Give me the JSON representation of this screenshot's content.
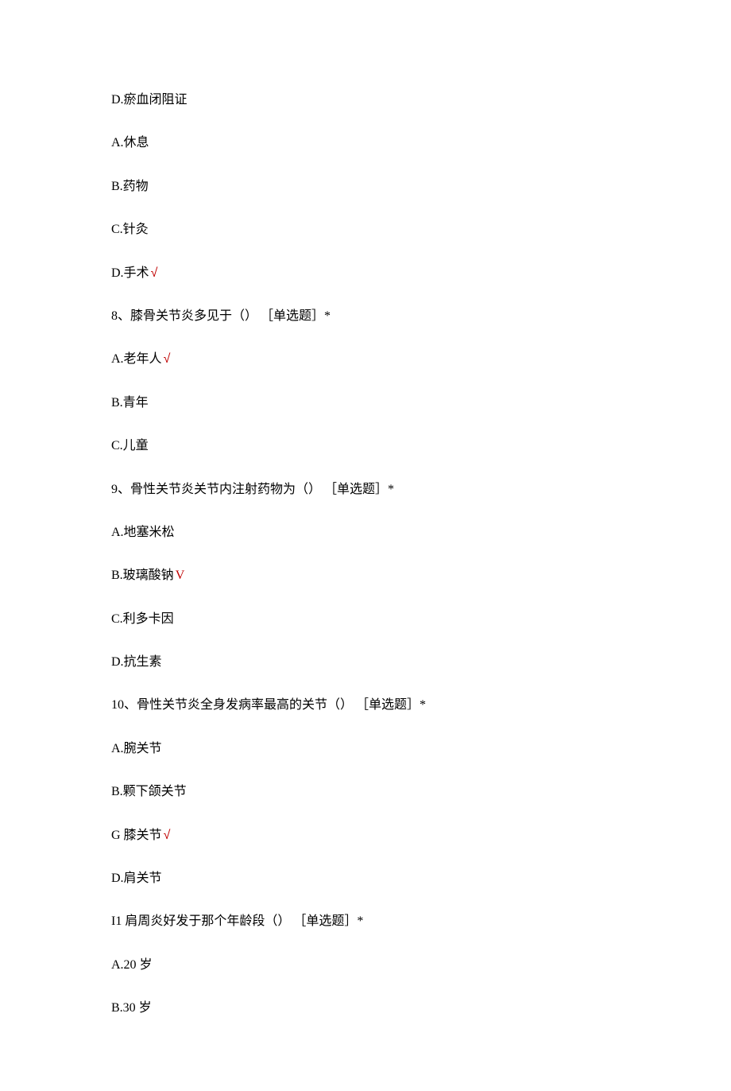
{
  "lines": [
    {
      "text": "D.瘀血闭阻证",
      "mark": null
    },
    {
      "text": "A.休息",
      "mark": null
    },
    {
      "text": "B.药物",
      "mark": null
    },
    {
      "text": "C.针灸",
      "mark": null
    },
    {
      "text": "D.手术",
      "mark": "check"
    },
    {
      "text": "8、膝骨关节炎多见于（） ［单选题］*",
      "mark": null
    },
    {
      "text": "A.老年人",
      "mark": "check"
    },
    {
      "text": "B.青年",
      "mark": null
    },
    {
      "text": "C.儿童",
      "mark": null
    },
    {
      "text": "9、骨性关节炎关节内注射药物为（） ［单选题］*",
      "mark": null
    },
    {
      "text": "A.地塞米松",
      "mark": null
    },
    {
      "text": "B.玻璃酸钠",
      "mark": "V"
    },
    {
      "text": "C.利多卡因",
      "mark": null
    },
    {
      "text": "D.抗生素",
      "mark": null
    },
    {
      "text": "10、骨性关节炎全身发病率最高的关节（） ［单选题］*",
      "mark": null
    },
    {
      "text": "A.腕关节",
      "mark": null
    },
    {
      "text": "B.颗下颌关节",
      "mark": null
    },
    {
      "text": "G 膝关节",
      "mark": "check"
    },
    {
      "text": "D.肩关节",
      "mark": null
    },
    {
      "text": "I1 肩周炎好发于那个年龄段（） ［单选题］*",
      "mark": null
    },
    {
      "text": "A.20 岁",
      "mark": null
    },
    {
      "text": "B.30 岁",
      "mark": null
    }
  ],
  "marks": {
    "check": "√",
    "V": "V"
  }
}
